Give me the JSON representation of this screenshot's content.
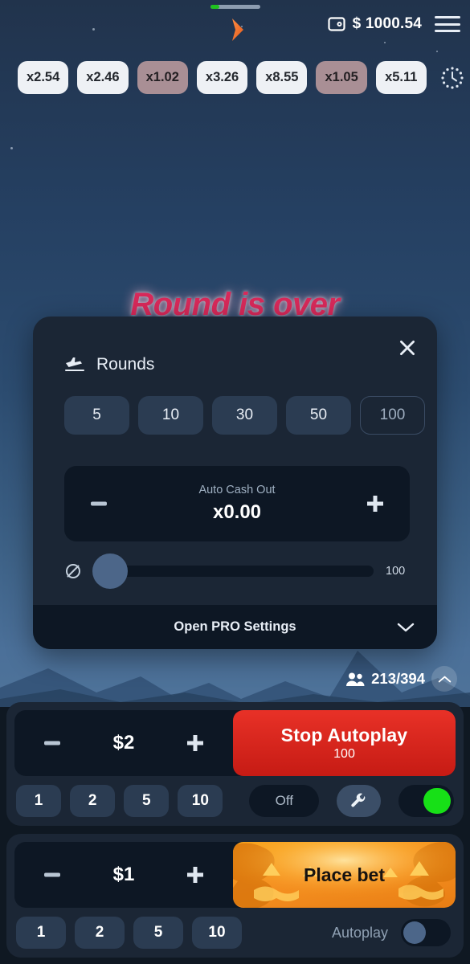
{
  "topbar": {
    "progress_percent": 18,
    "chevron_icon": "chevron-right-icon",
    "wallet_icon": "wallet-icon",
    "balance": "$ 1000.54",
    "menu_icon": "hamburger-menu-icon"
  },
  "history": {
    "clock_icon": "history-clock-icon",
    "items": [
      {
        "label": "x2.54",
        "low": false
      },
      {
        "label": "x2.46",
        "low": false
      },
      {
        "label": "x1.02",
        "low": true
      },
      {
        "label": "x3.26",
        "low": false
      },
      {
        "label": "x8.55",
        "low": false
      },
      {
        "label": "x1.05",
        "low": true
      },
      {
        "label": "x5.11",
        "low": false
      }
    ]
  },
  "game": {
    "status_text": "Round is over"
  },
  "modal": {
    "close_icon": "close-icon",
    "plane_icon": "plane-landing-icon",
    "title": "Rounds",
    "rounds": [
      {
        "label": "5",
        "selected": false
      },
      {
        "label": "10",
        "selected": false
      },
      {
        "label": "30",
        "selected": false
      },
      {
        "label": "50",
        "selected": false
      },
      {
        "label": "100",
        "selected": true
      }
    ],
    "auto_cash_out": {
      "label": "Auto Cash Out",
      "value": "x0.00",
      "minus_icon": "minus-icon",
      "plus_icon": "plus-icon"
    },
    "slider": {
      "icon": "no-entry-icon",
      "value": "100",
      "position_percent": 0
    },
    "pro_settings": {
      "label": "Open PRO Settings",
      "chevron_icon": "chevron-down-icon"
    }
  },
  "players": {
    "icon": "players-icon",
    "count": "213/394",
    "chevron_icon": "chevron-up-icon"
  },
  "bet_panels": [
    {
      "minus_icon": "minus-icon",
      "plus_icon": "plus-icon",
      "amount": "$2",
      "action_label": "Stop Autoplay",
      "action_sub": "100",
      "action_kind": "stop",
      "quick_amounts": [
        "1",
        "2",
        "5",
        "10"
      ],
      "off_label": "Off",
      "wrench_icon": "wrench-icon",
      "status_toggle_on": true
    },
    {
      "minus_icon": "minus-icon",
      "plus_icon": "plus-icon",
      "amount": "$1",
      "action_label": "Place bet",
      "action_sub": "",
      "action_kind": "place",
      "quick_amounts": [
        "1",
        "2",
        "5",
        "10"
      ],
      "autoplay_label": "Autoplay",
      "autoplay_on": false
    }
  ],
  "colors": {
    "accent_red": "#e83127",
    "accent_orange": "#f59021",
    "accent_green": "#17e017",
    "status_pink": "#d8295a",
    "panel_bg": "#1b2635",
    "inner_bg": "#0d1724"
  }
}
